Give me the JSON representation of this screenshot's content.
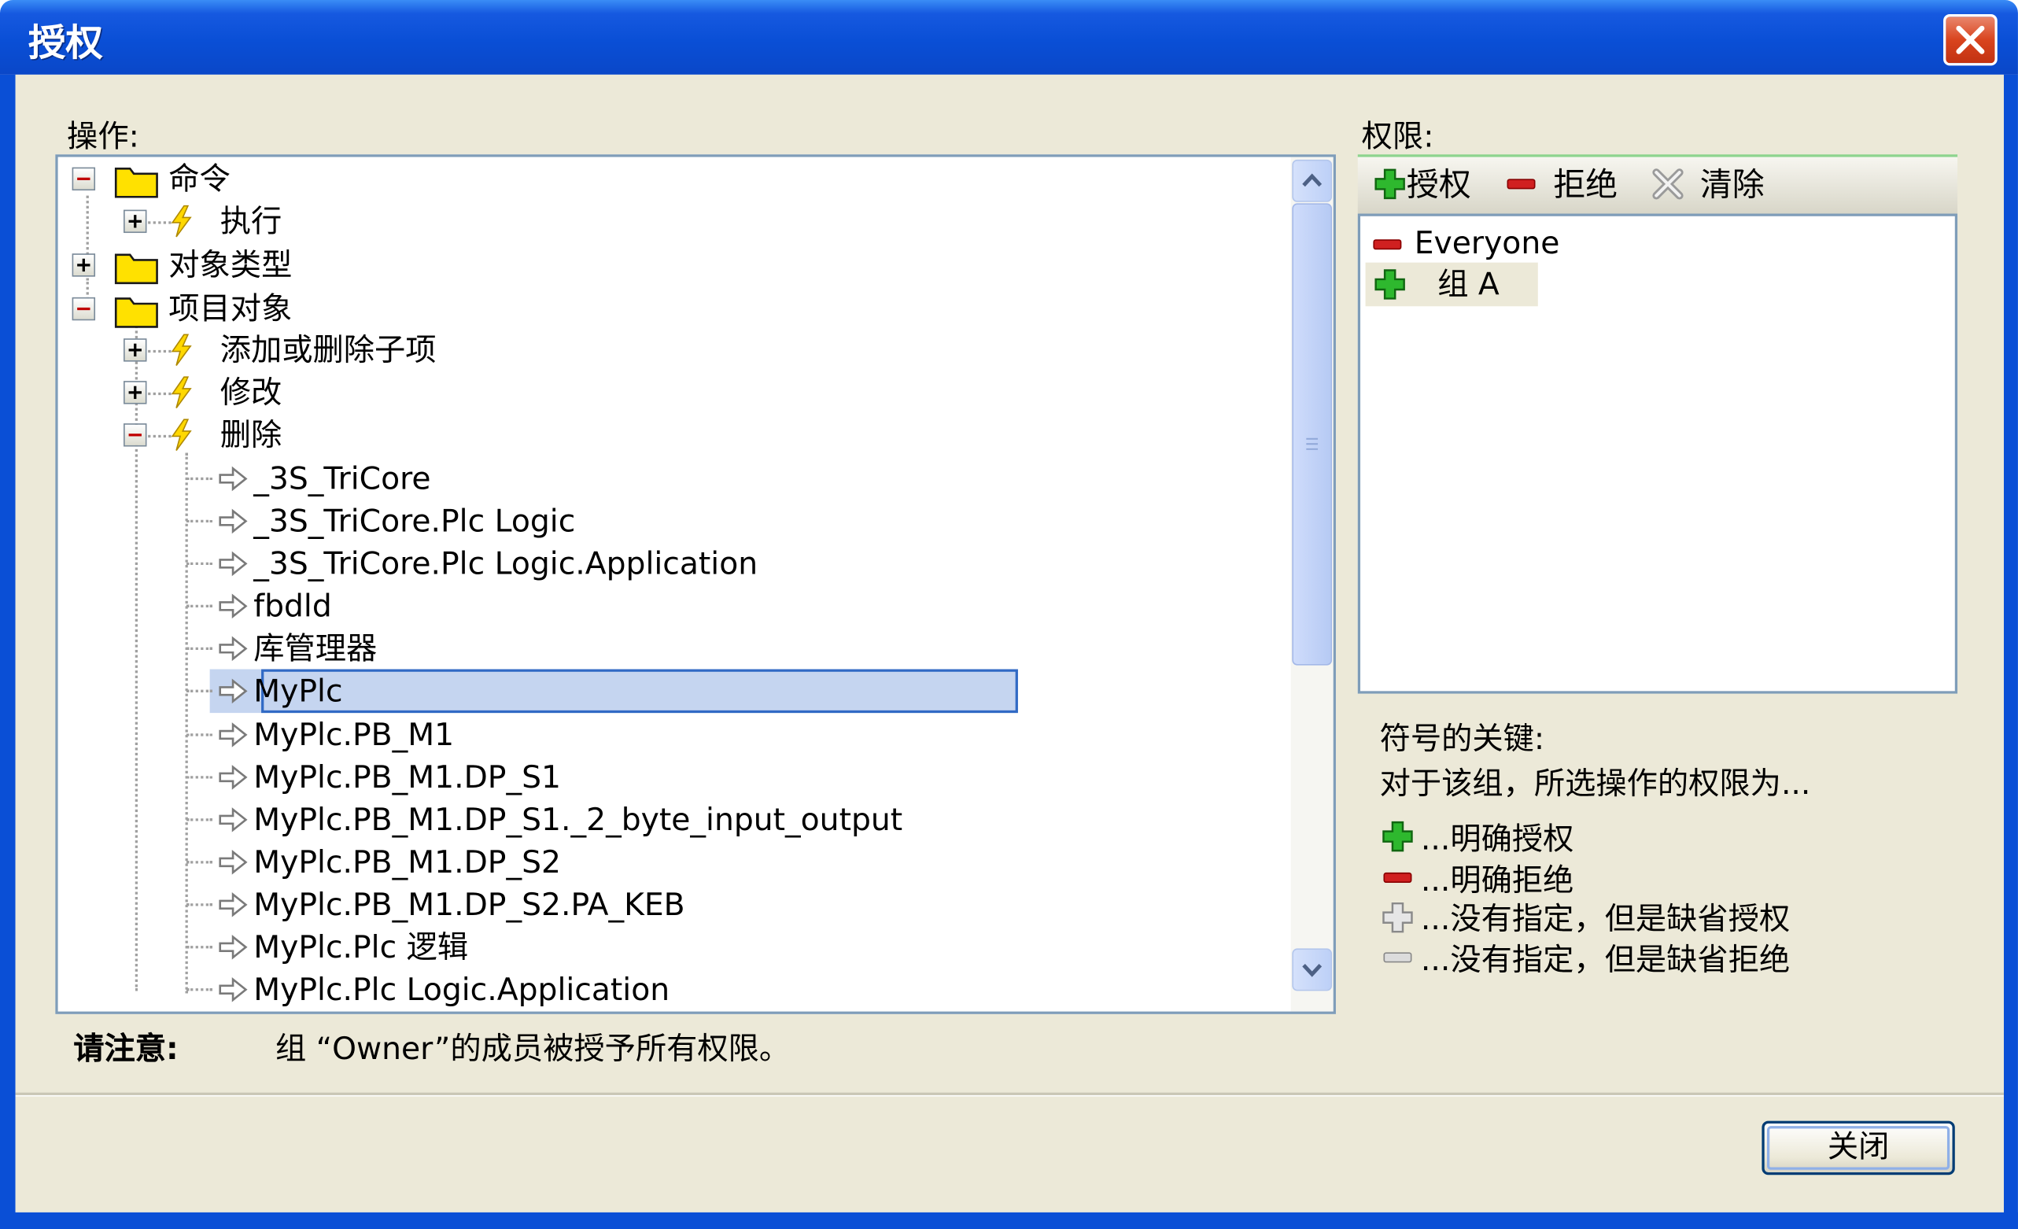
{
  "window": {
    "title": "授权"
  },
  "operations": {
    "label": "操作:",
    "tree": [
      {
        "id": "n0",
        "label": "命令",
        "kind": "folder",
        "expander": "minus"
      },
      {
        "id": "n1",
        "label": "执行",
        "kind": "action",
        "expander": "plus"
      },
      {
        "id": "n2",
        "label": "对象类型",
        "kind": "folder",
        "expander": "plus"
      },
      {
        "id": "n3",
        "label": "项目对象",
        "kind": "folder",
        "expander": "minus"
      },
      {
        "id": "n4",
        "label": "添加或删除子项",
        "kind": "action",
        "expander": "plus"
      },
      {
        "id": "n5",
        "label": "修改",
        "kind": "action",
        "expander": "plus"
      },
      {
        "id": "n6",
        "label": "删除",
        "kind": "action",
        "expander": "minus"
      },
      {
        "id": "n7",
        "label": "_3S_TriCore",
        "kind": "object"
      },
      {
        "id": "n8",
        "label": "_3S_TriCore.Plc Logic",
        "kind": "object"
      },
      {
        "id": "n9",
        "label": "_3S_TriCore.Plc Logic.Application",
        "kind": "object"
      },
      {
        "id": "n10",
        "label": "fbdld",
        "kind": "object"
      },
      {
        "id": "n11",
        "label": "库管理器",
        "kind": "object"
      },
      {
        "id": "n12",
        "label": "MyPlc",
        "kind": "object",
        "selected": true
      },
      {
        "id": "n13",
        "label": "MyPlc.PB_M1",
        "kind": "object"
      },
      {
        "id": "n14",
        "label": "MyPlc.PB_M1.DP_S1",
        "kind": "object"
      },
      {
        "id": "n15",
        "label": "MyPlc.PB_M1.DP_S1._2_byte_input_output",
        "kind": "object"
      },
      {
        "id": "n16",
        "label": "MyPlc.PB_M1.DP_S2",
        "kind": "object"
      },
      {
        "id": "n17",
        "label": "MyPlc.PB_M1.DP_S2.PA_KEB",
        "kind": "object"
      },
      {
        "id": "n18",
        "label": "MyPlc.Plc 逻辑",
        "kind": "object"
      },
      {
        "id": "n19",
        "label": "MyPlc.Plc Logic.Application",
        "kind": "object"
      }
    ]
  },
  "permissions": {
    "label": "权限:",
    "toolbar": {
      "grant": "授权",
      "deny": "拒绝",
      "clear": "清除"
    },
    "entries": [
      {
        "name": "Everyone",
        "state": "deny"
      },
      {
        "name": "组 A",
        "state": "grant"
      }
    ]
  },
  "legend": {
    "title": "符号的关键:",
    "subtitle": "对于该组，所选操作的权限为...",
    "items": [
      {
        "icon": "green-plus-icon",
        "text": "...明确授权"
      },
      {
        "icon": "red-minus-icon",
        "text": "...明确拒绝"
      },
      {
        "icon": "gray-plus-icon",
        "text": "...没有指定，但是缺省授权"
      },
      {
        "icon": "gray-minus-icon",
        "text": "...没有指定，但是缺省拒绝"
      }
    ]
  },
  "note": {
    "label": "请注意:",
    "text": "组 “Owner”的成员被授予所有权限。"
  },
  "buttons": {
    "close": "关闭"
  },
  "colors": {
    "titlebar": "#0a4fd6",
    "client": "#ece9d8",
    "selection": "#c5d5f0",
    "accent_green": "#22aa22",
    "accent_red": "#d02020"
  }
}
